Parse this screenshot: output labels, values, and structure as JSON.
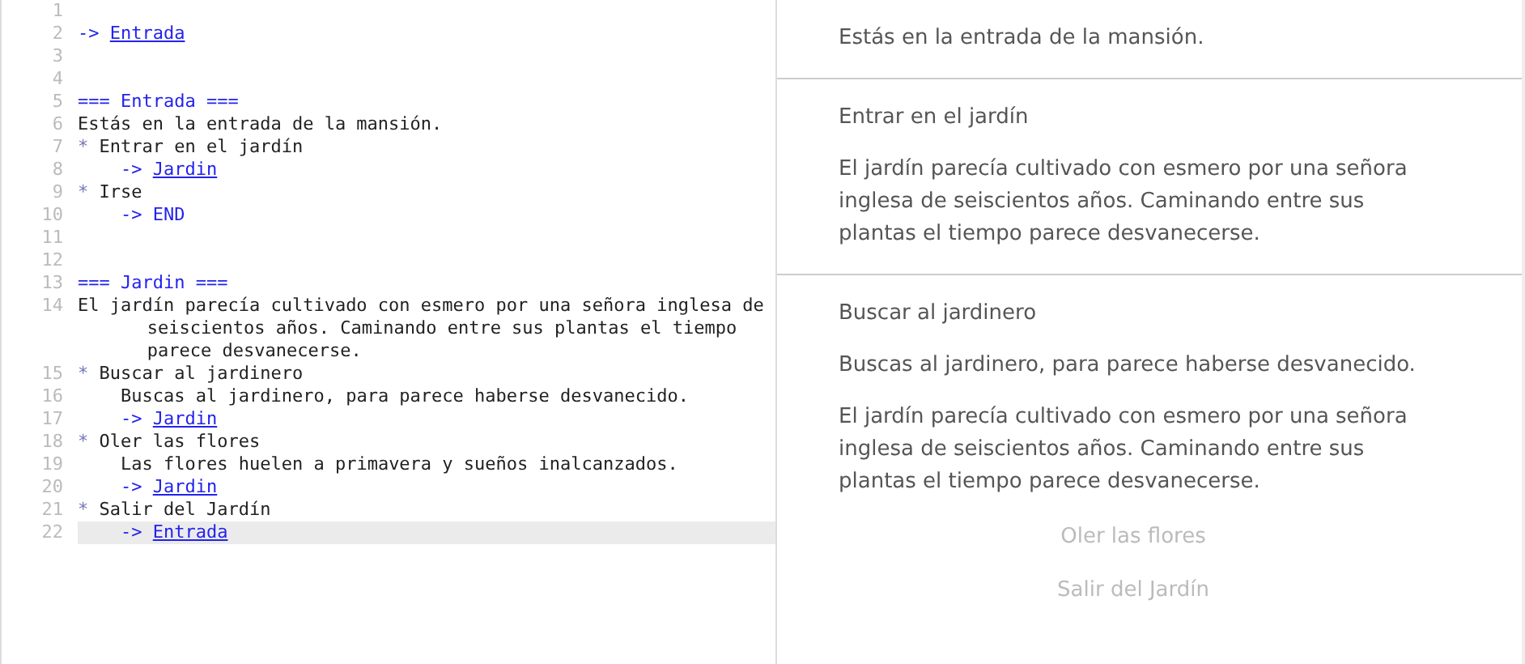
{
  "editor": {
    "lines": [
      {
        "number": "1",
        "active": false
      },
      {
        "number": "2",
        "active": false,
        "segments": [
          {
            "kind": "op",
            "text": "-> "
          },
          {
            "kind": "link",
            "text": "Entrada"
          }
        ]
      },
      {
        "number": "3",
        "active": false
      },
      {
        "number": "4",
        "active": false
      },
      {
        "number": "5",
        "active": false,
        "segments": [
          {
            "kind": "op",
            "text": "=== Entrada ==="
          }
        ]
      },
      {
        "number": "6",
        "active": false,
        "segments": [
          {
            "kind": "plain",
            "text": "Estás en la entrada de la mansión."
          }
        ]
      },
      {
        "number": "7",
        "active": false,
        "segments": [
          {
            "kind": "bullet",
            "text": "* "
          },
          {
            "kind": "plain",
            "text": "Entrar en el jardín"
          }
        ]
      },
      {
        "number": "8",
        "active": false,
        "segments": [
          {
            "kind": "op",
            "text": "    -> "
          },
          {
            "kind": "link",
            "text": "Jardin"
          }
        ]
      },
      {
        "number": "9",
        "active": false,
        "segments": [
          {
            "kind": "bullet",
            "text": "* "
          },
          {
            "kind": "plain",
            "text": "Irse"
          }
        ]
      },
      {
        "number": "10",
        "active": false,
        "segments": [
          {
            "kind": "op",
            "text": "    -> END"
          }
        ]
      },
      {
        "number": "11",
        "active": false
      },
      {
        "number": "12",
        "active": false
      },
      {
        "number": "13",
        "active": false,
        "segments": [
          {
            "kind": "op",
            "text": "=== Jardin ==="
          }
        ]
      },
      {
        "number": "14",
        "active": false,
        "segments": [
          {
            "kind": "plain",
            "text": "El jardín parecía cultivado con esmero por una señora inglesa de seiscientos años. Caminando entre sus plantas el tiempo parece desvanecerse."
          }
        ]
      },
      {
        "number": "15",
        "active": false,
        "segments": [
          {
            "kind": "bullet",
            "text": "* "
          },
          {
            "kind": "plain",
            "text": "Buscar al jardinero"
          }
        ]
      },
      {
        "number": "16",
        "active": false,
        "segments": [
          {
            "kind": "plain",
            "text": "    Buscas al jardinero, para parece haberse desvanecido."
          }
        ]
      },
      {
        "number": "17",
        "active": false,
        "segments": [
          {
            "kind": "op",
            "text": "    -> "
          },
          {
            "kind": "link",
            "text": "Jardin"
          }
        ]
      },
      {
        "number": "18",
        "active": false,
        "segments": [
          {
            "kind": "bullet",
            "text": "* "
          },
          {
            "kind": "plain",
            "text": "Oler las flores"
          }
        ]
      },
      {
        "number": "19",
        "active": false,
        "segments": [
          {
            "kind": "plain",
            "text": "    Las flores huelen a primavera y sueños inalcanzados."
          }
        ]
      },
      {
        "number": "20",
        "active": false,
        "segments": [
          {
            "kind": "op",
            "text": "    -> "
          },
          {
            "kind": "link",
            "text": "Jardin"
          }
        ]
      },
      {
        "number": "21",
        "active": false,
        "segments": [
          {
            "kind": "bullet",
            "text": "* "
          },
          {
            "kind": "plain",
            "text": "Salir del Jardín"
          }
        ]
      },
      {
        "number": "22",
        "active": true,
        "segments": [
          {
            "kind": "op",
            "text": "    -> "
          },
          {
            "kind": "link",
            "text": "Entrada"
          }
        ]
      }
    ]
  },
  "story": {
    "sections": [
      {
        "paragraphs": [
          "Estás en la entrada de la mansión."
        ]
      },
      {
        "choice": "Entrar en el jardín",
        "paragraphs": [
          "El jardín parecía cultivado con esmero por una señora inglesa de seiscientos años. Caminando entre sus plantas el tiempo parece desvanecerse."
        ]
      },
      {
        "choice": "Buscar al jardinero",
        "paragraphs": [
          "Buscas al jardinero, para parece haberse desvanecido.",
          "El jardín parecía cultivado con esmero por una señora inglesa de seiscientos años. Caminando entre sus plantas el tiempo parece desvanecerse."
        ]
      }
    ],
    "choices": [
      "Oler las flores",
      "Salir del Jardín"
    ]
  }
}
